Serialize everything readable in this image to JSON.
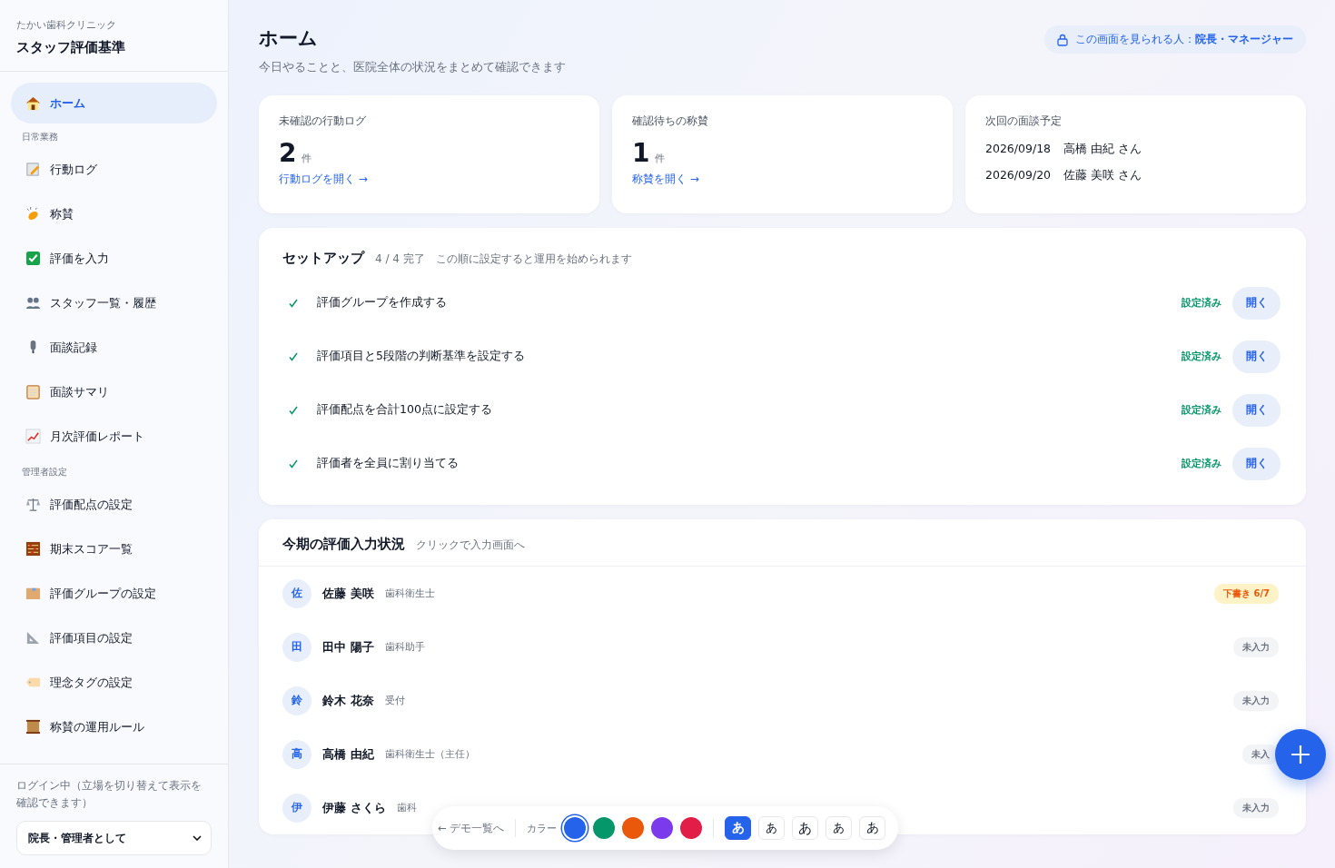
{
  "sidebar": {
    "clinic": "たかい歯科クリニック",
    "title": "スタッフ評価基準",
    "home": {
      "label": "ホーム",
      "selected": true
    },
    "sections": [
      {
        "heading": "日常業務",
        "items": [
          {
            "label": "行動ログ",
            "selected": false
          },
          {
            "label": "称賛",
            "selected": false
          },
          {
            "label": "評価を入力",
            "selected": false
          },
          {
            "label": "スタッフ一覧・履歴",
            "selected": false
          },
          {
            "label": "面談記録",
            "selected": false
          },
          {
            "label": "面談サマリ",
            "selected": false
          },
          {
            "label": "月次評価レポート",
            "selected": false
          }
        ]
      },
      {
        "heading": "管理者設定",
        "items": [
          {
            "label": "評価配点の設定",
            "selected": false
          },
          {
            "label": "期末スコア一覧",
            "selected": false
          },
          {
            "label": "評価グループの設定",
            "selected": false
          },
          {
            "label": "評価項目の設定",
            "selected": false
          },
          {
            "label": "理念タグの設定",
            "selected": false
          },
          {
            "label": "称賛の運用ルール",
            "selected": false
          }
        ]
      }
    ],
    "login_note": "ログイン中（立場を切り替えて表示を確認できます）",
    "role_select": "院長・管理者として"
  },
  "header": {
    "title": "ホーム",
    "subtitle": "今日やることと、医院全体の状況をまとめて確認できます",
    "access_prefix": "この画面を見られる人：",
    "access_roles": "院長・マネージャー"
  },
  "cards": [
    {
      "kind": "count",
      "title": "未確認の行動ログ",
      "count": "2",
      "unit": "件",
      "link": "行動ログを開く →"
    },
    {
      "kind": "count",
      "title": "確認待ちの称賛",
      "count": "1",
      "unit": "件",
      "link": "称賛を開く →"
    },
    {
      "kind": "schedule",
      "title": "次回の面談予定",
      "entries": [
        {
          "date": "2026/09/18",
          "name": "高橋 由紀 さん"
        },
        {
          "date": "2026/09/20",
          "name": "佐藤 美咲 さん"
        }
      ]
    }
  ],
  "setup": {
    "title": "セットアップ",
    "progress": "4 / 4 完了",
    "hint": "この順に設定すると運用を始められます",
    "steps": [
      {
        "label": "評価グループを作成する",
        "done": true,
        "status": "設定済み",
        "button": "開く"
      },
      {
        "label": "評価項目と5段階の判断基準を設定する",
        "done": true,
        "status": "設定済み",
        "button": "開く"
      },
      {
        "label": "評価配点を合計100点に設定する",
        "done": true,
        "status": "設定済み",
        "button": "開く"
      },
      {
        "label": "評価者を全員に割り当てる",
        "done": true,
        "status": "設定済み",
        "button": "開く"
      }
    ]
  },
  "status": {
    "title": "今期の評価入力状況",
    "hint": "クリックで入力画面へ",
    "staff": [
      {
        "initial": "佐",
        "name": "佐藤 美咲",
        "role": "歯科衛生士",
        "badge": "下書き 6/7",
        "kind": "draft"
      },
      {
        "initial": "田",
        "name": "田中 陽子",
        "role": "歯科助手",
        "badge": "未入力",
        "kind": "empty"
      },
      {
        "initial": "鈴",
        "name": "鈴木 花奈",
        "role": "受付",
        "badge": "未入力",
        "kind": "empty"
      },
      {
        "initial": "高",
        "name": "高橋 由紀",
        "role": "歯科衛生士（主任）",
        "badge": "未入",
        "kind": "empty"
      },
      {
        "initial": "伊",
        "name": "伊藤 さくら",
        "role": "歯科",
        "badge": "未入力",
        "kind": "empty"
      }
    ]
  },
  "demo_bar": {
    "back": "← デモ一覧へ",
    "color_label": "カラー",
    "colors": [
      {
        "color": "#2563eb",
        "selected": true
      },
      {
        "color": "#059669",
        "selected": false
      },
      {
        "color": "#ea580c",
        "selected": false
      },
      {
        "color": "#7c3aed",
        "selected": false
      },
      {
        "color": "#e11d48",
        "selected": false
      }
    ],
    "fonts": [
      {
        "label": "あ",
        "selected": true
      },
      {
        "label": "あ",
        "selected": false
      },
      {
        "label": "あ",
        "selected": false
      },
      {
        "label": "あ",
        "selected": false
      },
      {
        "label": "あ",
        "selected": false
      }
    ]
  }
}
